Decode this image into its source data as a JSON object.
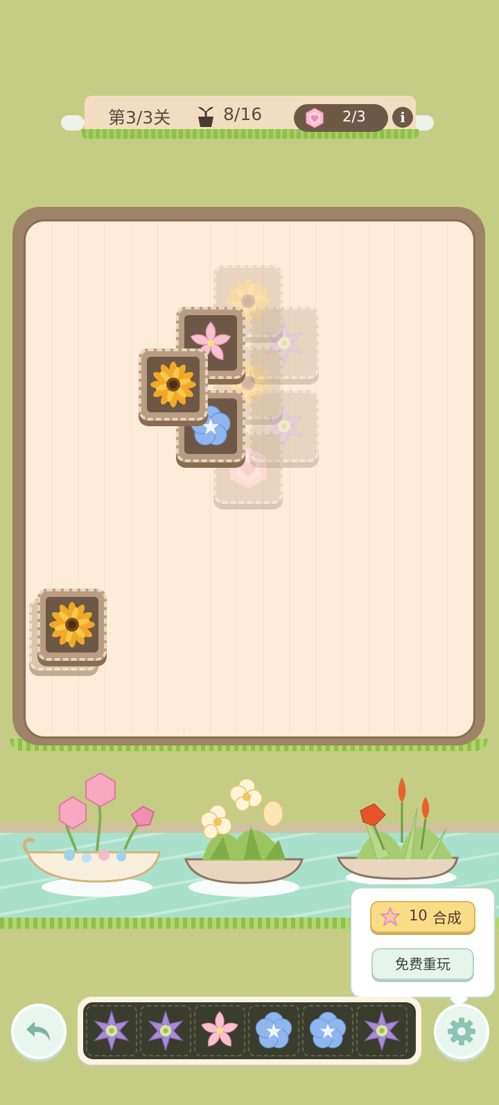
{
  "hud": {
    "level": "第3/3关",
    "pot_progress": "8/16",
    "gem_progress": "2/3",
    "info_label": "i"
  },
  "board": {
    "tiles": [
      {
        "flower": "sunflower",
        "state": "faded"
      },
      {
        "flower": "purple-clematis",
        "state": "faded"
      },
      {
        "flower": "pink-lily",
        "state": "active"
      },
      {
        "flower": "sunflower",
        "state": "faded"
      },
      {
        "flower": "purple-clematis",
        "state": "faded"
      },
      {
        "flower": "blue-pansy",
        "state": "active"
      },
      {
        "flower": "pink-gem",
        "state": "faded"
      },
      {
        "flower": "sunflower",
        "state": "active"
      },
      {
        "flower": "sunflower",
        "state": "active"
      }
    ]
  },
  "boats": [
    "pink-gem-plant",
    "white-buttercup-plant",
    "orange-lily-plant"
  ],
  "popup": {
    "merge_count": "10",
    "merge_label": "合成",
    "replay_label": "免费重玩"
  },
  "tray": {
    "slots": [
      "purple-clematis",
      "purple-clematis",
      "pink-lily",
      "blue-pansy",
      "blue-pansy",
      "purple-clematis"
    ]
  },
  "colors": {
    "background": "#c5cd85",
    "board": "#fcecd8",
    "river": "#a8e0cc",
    "merge_button": "#f9dc87"
  }
}
